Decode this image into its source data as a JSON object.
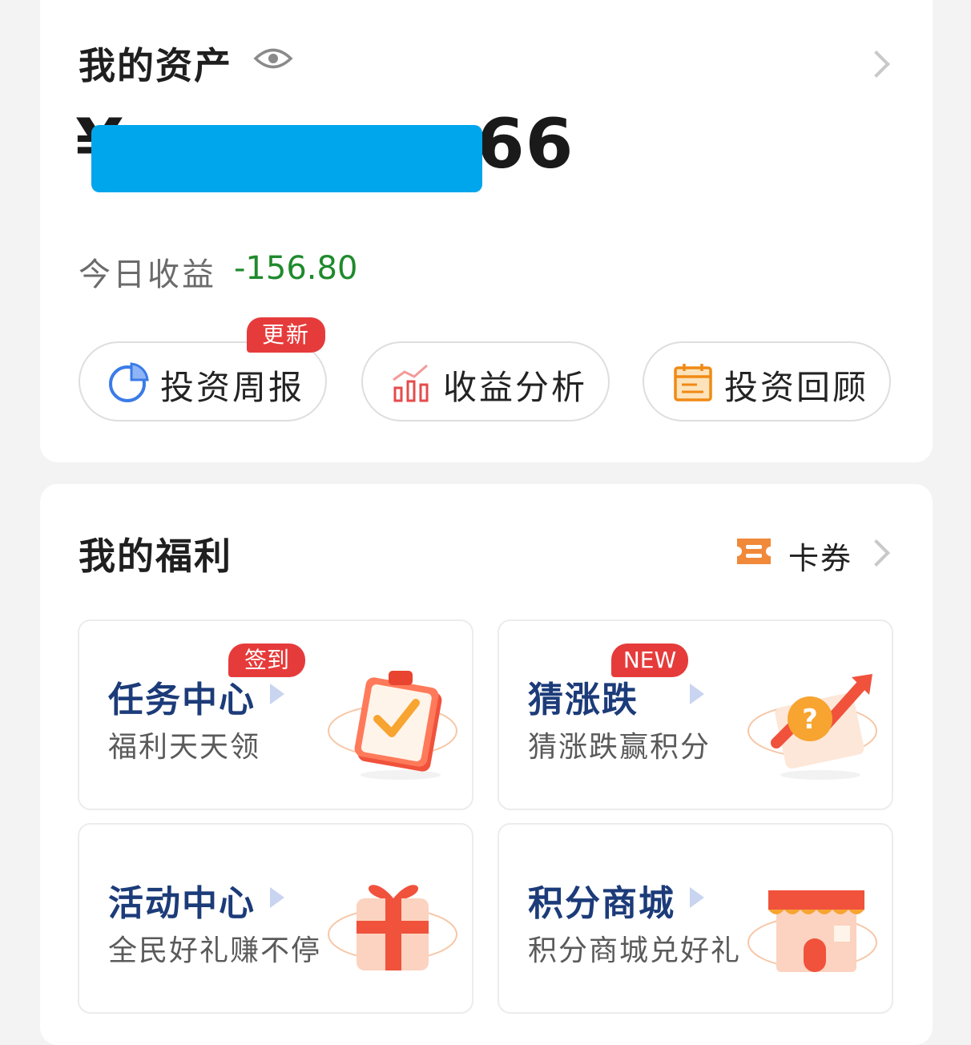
{
  "assets": {
    "title": "我的资产",
    "amount_visible": "¥ 66",
    "amount_prefix": "¥",
    "amount_suffix": "66",
    "today_label": "今日收益",
    "today_value": "-156.80",
    "buttons": [
      {
        "label": "投资周报",
        "badge": "更新"
      },
      {
        "label": "收益分析"
      },
      {
        "label": "投资回顾"
      }
    ]
  },
  "welfare": {
    "title": "我的福利",
    "coupon_label": "卡券",
    "tiles": [
      {
        "title": "任务中心",
        "subtitle": "福利天天领",
        "badge": "签到"
      },
      {
        "title": "猜涨跌",
        "subtitle": "猜涨跌赢积分",
        "badge": "NEW"
      },
      {
        "title": "活动中心",
        "subtitle": "全民好礼赚不停"
      },
      {
        "title": "积分商城",
        "subtitle": "积分商城兑好礼"
      }
    ]
  },
  "colors": {
    "mask": "#00a6ec",
    "negative_income": "#1f8a2c",
    "badge": "#e63b3b",
    "tile_title": "#1c3b79"
  }
}
